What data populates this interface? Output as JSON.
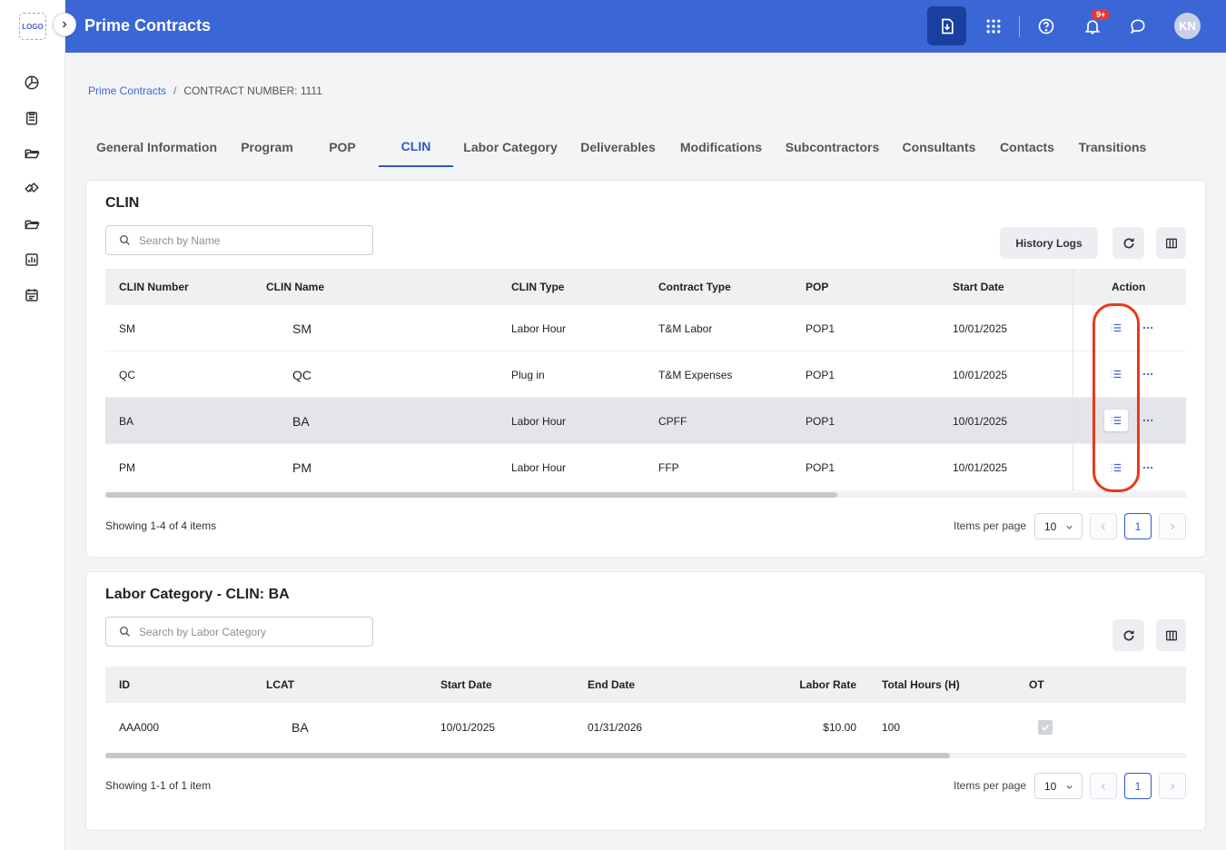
{
  "app": {
    "logo_text": "LOGO",
    "title": "Prime Contracts"
  },
  "header": {
    "notification_badge": "9+",
    "avatar_initials": "KN"
  },
  "breadcrumb": {
    "root": "Prime Contracts",
    "separator": "/",
    "current": "CONTRACT NUMBER: 1111"
  },
  "tabs": [
    "General Information",
    "Program",
    "POP",
    "CLIN",
    "Labor Category",
    "Deliverables",
    "Modifications",
    "Subcontractors",
    "Consultants",
    "Contacts",
    "Transitions"
  ],
  "active_tab": "CLIN",
  "clin": {
    "title": "CLIN",
    "search_placeholder": "Search by Name",
    "history_button": "History Logs",
    "columns": [
      "CLIN Number",
      "CLIN Name",
      "CLIN Type",
      "Contract Type",
      "POP",
      "Start Date",
      "Action"
    ],
    "rows": [
      {
        "number": "SM",
        "name": "SM",
        "type": "Labor Hour",
        "contract_type": "T&M Labor",
        "pop": "POP1",
        "start": "10/01/2025"
      },
      {
        "number": "QC",
        "name": "QC",
        "type": "Plug in",
        "contract_type": "T&M Expenses",
        "pop": "POP1",
        "start": "10/01/2025"
      },
      {
        "number": "BA",
        "name": "BA",
        "type": "Labor Hour",
        "contract_type": "CPFF",
        "pop": "POP1",
        "start": "10/01/2025"
      },
      {
        "number": "PM",
        "name": "PM",
        "type": "Labor Hour",
        "contract_type": "FFP",
        "pop": "POP1",
        "start": "10/01/2025"
      }
    ],
    "selected_row": "BA",
    "showing": "Showing 1-4 of 4 items",
    "items_per_page_label": "Items per page",
    "items_per_page": "10",
    "current_page": "1"
  },
  "labor": {
    "title": "Labor Category - CLIN: BA",
    "search_placeholder": "Search by Labor Category",
    "columns": [
      "ID",
      "LCAT",
      "Start Date",
      "End Date",
      "Labor Rate",
      "Total Hours (H)",
      "OT"
    ],
    "rows": [
      {
        "id": "AAA000",
        "lcat": "BA",
        "start": "10/01/2025",
        "end": "01/31/2026",
        "rate": "$10.00",
        "hours": "100",
        "ot": true
      }
    ],
    "showing": "Showing 1-1 of 1 item",
    "items_per_page_label": "Items per page",
    "items_per_page": "10",
    "current_page": "1"
  },
  "colors": {
    "primary": "#3a66d6",
    "primary_dark": "#1a3f9e",
    "highlight": "#e8391d",
    "badge": "#e53935"
  }
}
